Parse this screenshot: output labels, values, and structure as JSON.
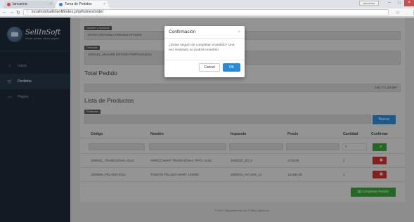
{
  "browser": {
    "tabs": [
      {
        "label": "tancarina"
      },
      {
        "label": "Toma de Pedidos"
      }
    ],
    "url": "localhost/sellinsoft/index.php/homes/order",
    "user_badge": "tancarina"
  },
  "app": {
    "logo_text": "SellInSoft",
    "logo_sub": "Vende, predice, ¡fácil y seguro!"
  },
  "sidebar": {
    "items": [
      {
        "label": "Inicio",
        "icon": "home-icon"
      },
      {
        "label": "Pedidos",
        "icon": "cart-icon"
      },
      {
        "label": "Pagos",
        "icon": "card-icon"
      }
    ]
  },
  "form": {
    "client_label": "Nombre y Apellidos",
    "client_value": "MARIA GRACIELA FREITEZ ATACHO",
    "address_label": "Dirección",
    "address_value": "1000161_ARAURE ESTADO PORTUGUESA",
    "total_title": "Total Pedido",
    "total_value": "106,771.20 BsF",
    "products_title": "Lista de Productos",
    "products_label": "Productos",
    "search_button": "Buscar"
  },
  "table": {
    "headers": [
      "Código",
      "Nombre",
      "Impuesto",
      "Precio",
      "Cantidad",
      "Confirmar"
    ],
    "input_row_qty": "0",
    "rows": [
      {
        "code": "1000011_TRADICIONAL-0124",
        "name": "ARROZ MARY TRADICIONAL TIPO I 24X1",
        "tax": "1000530_(E)_0",
        "price": "2733.60",
        "qty": "2"
      },
      {
        "code": "1000659_PELADO-0212",
        "name": "TOMATE PELADO MARY 12X800",
        "tax": "1000014_IVA 12%_12",
        "price": "101184.00",
        "qty": "1"
      }
    ],
    "complete_button": "Completar Pedido"
  },
  "footer": "© 2017 Departamento de TI Mary tancarina",
  "modal": {
    "title": "Confirmación",
    "close": "×",
    "message": "¿Estas seguro de completar el pedido? Una vez realizado no podrás revertirlo",
    "cancel": "Cancel",
    "ok": "OK"
  }
}
